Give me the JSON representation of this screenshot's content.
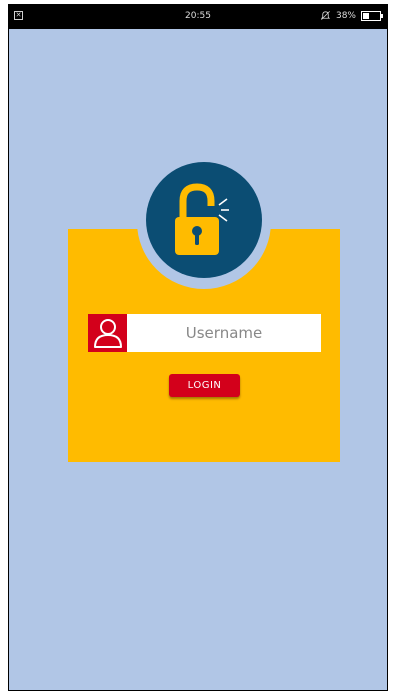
{
  "status_bar": {
    "time": "20:55",
    "battery": "38%",
    "battery_level": 0.38,
    "notification_icon": "close-box-icon",
    "silent_icon": "bell-off-icon"
  },
  "login": {
    "lock_icon": "unlock-icon",
    "user_icon": "user-icon",
    "username_placeholder": "Username",
    "login_label": "LOGIN"
  },
  "colors": {
    "background": "#b1c6e6",
    "card": "#ffbb00",
    "lock_circle": "#0b4d73",
    "accent_red": "#d3001b"
  }
}
